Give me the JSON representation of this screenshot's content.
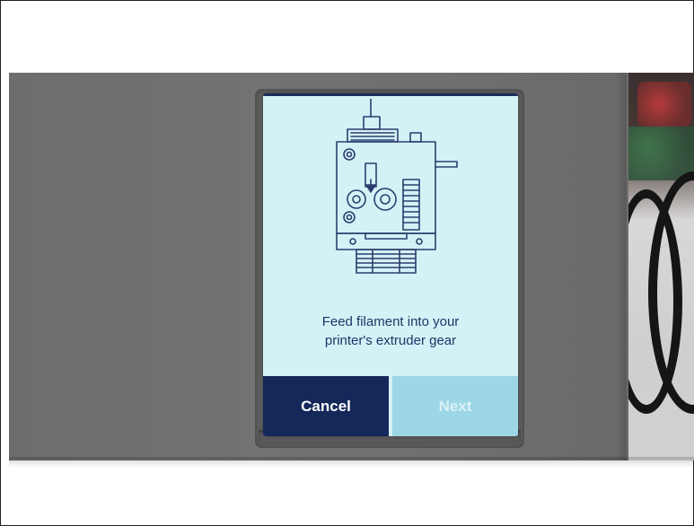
{
  "screen": {
    "instruction_line1": "Feed filament into your",
    "instruction_line2": "printer's extruder gear"
  },
  "buttons": {
    "cancel_label": "Cancel",
    "next_label": "Next",
    "next_enabled": false
  },
  "icons": {
    "illustration": "extruder-gear-icon",
    "arrow": "arrow-down-icon"
  },
  "colors": {
    "screen_bg": "#d4f1f6",
    "primary": "#14285a",
    "disabled_button": "#9dd6e6",
    "text": "#1e3568"
  }
}
